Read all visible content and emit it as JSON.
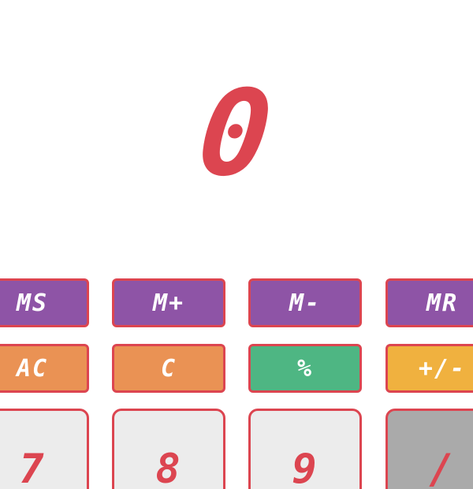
{
  "display": {
    "value": "0"
  },
  "memory_row": {
    "ms": "MS",
    "m_plus": "M+",
    "m_minus": "M-",
    "mr": "MR"
  },
  "function_row": {
    "ac": "AC",
    "c": "C",
    "percent": "%",
    "sign": "+/-"
  },
  "digit_row": {
    "seven": "7",
    "eight": "8",
    "nine": "9",
    "divide": "/"
  },
  "colors": {
    "accent": "#dc4550",
    "memory": "#8e54a6",
    "clear": "#ea9254",
    "percent": "#4eb683",
    "sign": "#f0b13f",
    "digit": "#ececec",
    "operator": "#aaaaaa"
  }
}
